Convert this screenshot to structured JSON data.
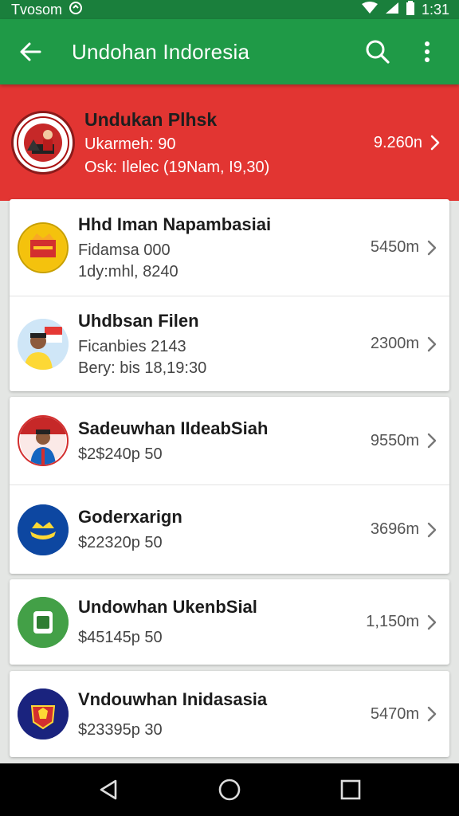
{
  "status_bar": {
    "time": "Tvosom",
    "clock": "1:31"
  },
  "app_bar": {
    "title": "Undohan Indoresia"
  },
  "header": {
    "title": "Undukan Plhsk",
    "subtitle": "Ukarmeh: 90",
    "meta": "Osk: Ilelec (19Nam, I9,30)",
    "amount": "9.260n"
  },
  "items": [
    {
      "title": "Hhd Iman Napambasiai",
      "line1": "Fidamsa 000",
      "line2": "1dy:mhl, 8240",
      "amount": "5450m"
    },
    {
      "title": "Uhdbsan Filen",
      "line1": "Ficanbies 2143",
      "line2": "Bery: bis 18,19:30",
      "amount": "2300m"
    },
    {
      "title": "Sadeuwhan IIdeabSiah",
      "line1": "$2$240p 50",
      "amount": "9550m"
    },
    {
      "title": "Goderxarign",
      "line1": "$22320p 50",
      "amount": "3696m"
    },
    {
      "title": "Undowhan UkenbSial",
      "line1": "$45145p 50",
      "amount": "1,150m"
    },
    {
      "title": "Vndouwhan Inidasasia",
      "line1": "$23395p 30",
      "amount": "5470m"
    }
  ],
  "colors": {
    "app_bar": "#1f9a47",
    "status_bar": "#1a7f3c",
    "header": "#e23532"
  },
  "icons": [
    "back-arrow-icon",
    "search-icon",
    "more-vert-icon",
    "chevron-right-icon",
    "nav-back-icon",
    "nav-home-icon",
    "nav-recents-icon"
  ]
}
